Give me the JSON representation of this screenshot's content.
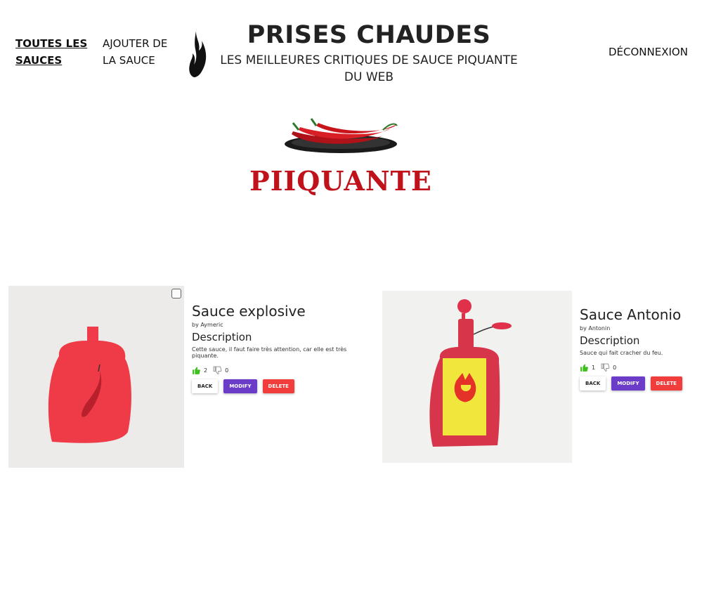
{
  "nav": {
    "all_sauces": "TOUTES LES SAUCES",
    "add_sauce": "AJOUTER DE LA SAUCE",
    "logout": "DÉCONNEXION"
  },
  "header": {
    "title": "PRISES CHAUDES",
    "subtitle": "LES MEILLEURES CRITIQUES DE SAUCE PIQUANTE DU WEB"
  },
  "logo": {
    "text": "PIIQUANTE"
  },
  "sauces": [
    {
      "name": "Sauce explosive",
      "by": "by Aymeric",
      "description_heading": "Description",
      "description": "Cette sauce, il faut faire très attention, car elle est très piquante.",
      "likes": "2",
      "dislikes": "0",
      "back_label": "BACK",
      "modify_label": "MODIFY",
      "delete_label": "DELETE"
    },
    {
      "name": "Sauce Antonio",
      "by": "by Antonin",
      "description_heading": "Description",
      "description": "Sauce qui fait cracher du feu.",
      "likes": "1",
      "dislikes": "0",
      "back_label": "BACK",
      "modify_label": "MODIFY",
      "delete_label": "DELETE"
    }
  ],
  "colors": {
    "brand_red": "#c0121a",
    "modify": "#6a3cc7",
    "delete": "#f23d3d",
    "like": "#3fbf1f"
  }
}
